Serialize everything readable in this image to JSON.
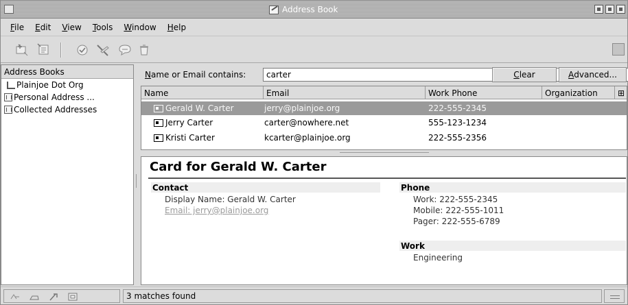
{
  "window": {
    "title": "Address Book"
  },
  "menu": {
    "items": [
      {
        "pre": "",
        "mnemonic": "F",
        "post": "ile"
      },
      {
        "pre": "",
        "mnemonic": "E",
        "post": "dit"
      },
      {
        "pre": "",
        "mnemonic": "V",
        "post": "iew"
      },
      {
        "pre": "",
        "mnemonic": "T",
        "post": "ools"
      },
      {
        "pre": "",
        "mnemonic": "W",
        "post": "indow"
      },
      {
        "pre": "",
        "mnemonic": "H",
        "post": "elp"
      }
    ]
  },
  "toolbar": {
    "icons": [
      "new-card-icon",
      "new-list-icon",
      "properties-icon",
      "compose-icon",
      "chat-icon",
      "delete-icon"
    ]
  },
  "sidebar": {
    "header": "Address Books",
    "items": [
      {
        "label": "Plainjoe Dot Org",
        "icon": "ldap-directory-icon"
      },
      {
        "label": "Personal Address ...",
        "icon": "address-book-icon"
      },
      {
        "label": "Collected Addresses",
        "icon": "address-book-icon"
      }
    ]
  },
  "search": {
    "label_mnemonic": "N",
    "label_rest": "ame or Email contains:",
    "value": "carter",
    "clear_mnemonic": "C",
    "clear_rest": "lear",
    "advanced_mnemonic": "A",
    "advanced_rest": "dvanced..."
  },
  "results": {
    "columns": [
      "Name",
      "Email",
      "Work Phone",
      "Organization"
    ],
    "rows": [
      {
        "name": "Gerald W. Carter",
        "email": "jerry@plainjoe.org",
        "phone": "222-555-2345",
        "org": "",
        "selected": true
      },
      {
        "name": "Jerry Carter",
        "email": "carter@nowhere.net",
        "phone": "555-123-1234",
        "org": "",
        "selected": false
      },
      {
        "name": "Kristi Carter",
        "email": "kcarter@plainjoe.org",
        "phone": "222-555-2356",
        "org": "",
        "selected": false
      }
    ]
  },
  "card": {
    "title": "Card for Gerald W. Carter",
    "contact_header": "Contact",
    "display_name": "Display Name: Gerald W. Carter",
    "email": "Email: jerry@plainjoe.org",
    "phone_header": "Phone",
    "work_phone": "Work: 222-555-2345",
    "mobile_phone": "Mobile: 222-555-1011",
    "pager": "Pager: 222-555-6789",
    "work_header": "Work",
    "department": "Engineering"
  },
  "status": {
    "text": "3 matches found",
    "icons": [
      "offline-icon",
      "security-icon",
      "load-icon",
      "download-icon"
    ]
  },
  "colors": {
    "selection": "#9a9a9a",
    "chrome": "#dcdcdc",
    "link": "#9a9a9a"
  }
}
